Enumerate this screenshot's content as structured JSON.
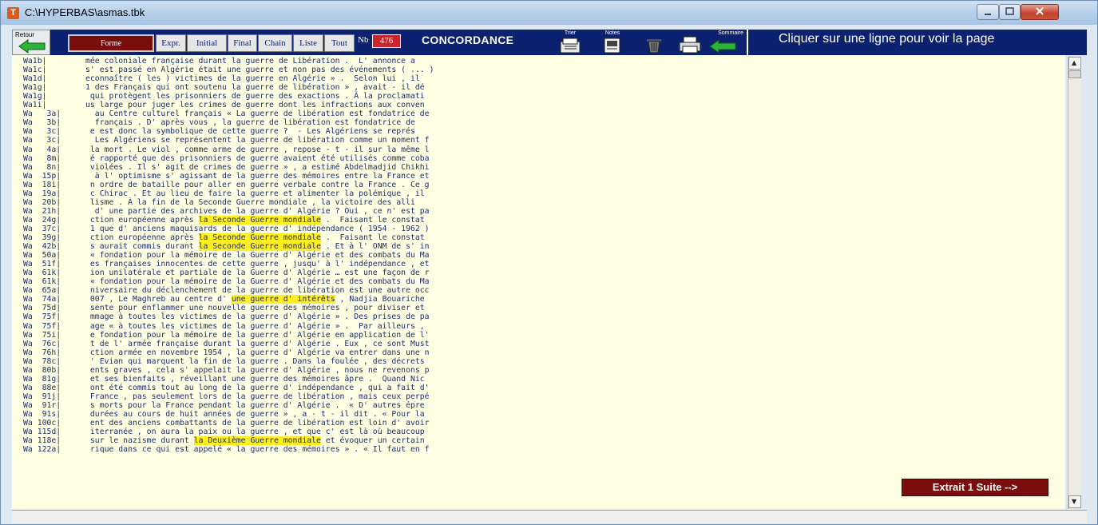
{
  "window": {
    "title": "C:\\HYPERBAS\\asmas.tbk",
    "app_icon": "T"
  },
  "toolbar": {
    "retour_label": "Retour",
    "forme_label": "Forme",
    "expr_label": "Expr.",
    "initial_label": "Initial",
    "final_label": "Final",
    "chain_label": "Chain",
    "liste_label": "Liste",
    "tout_label": "Tout",
    "nb_label": "Nb",
    "nb_value": "476",
    "title": "CONCORDANCE",
    "trier_label": "Trier",
    "notes_label": "Notes",
    "sommaire_label": "Sommaire",
    "message": "Cliquer sur une ligne pour voir la page"
  },
  "concordance": [
    {
      "ref": "Wa1b|",
      "pre": "mée coloniale française durant la guerre de Libération .  L' annonce a",
      "hl": "",
      "post": ""
    },
    {
      "ref": "Wa1c|",
      "pre": "s' est passé en Algérie était une guerre et non pas des événements ( ... )",
      "hl": "",
      "post": ""
    },
    {
      "ref": "Wa1d|",
      "pre": "econnaître ( les ) victimes de la guerre en Algérie » .  Selon lui , il",
      "hl": "",
      "post": ""
    },
    {
      "ref": "Wa1g|",
      "pre": "1 des Français qui ont soutenu la guerre de libération » , avait - il dé",
      "hl": "",
      "post": ""
    },
    {
      "ref": "Wa1g|",
      "pre": " qui protègent les prisonniers de guerre des exactions . À la proclamati",
      "hl": "",
      "post": ""
    },
    {
      "ref": "Wa1i|",
      "pre": "us large pour juger les crimes de guerre dont les infractions aux conven",
      "hl": "",
      "post": ""
    },
    {
      "ref": "Wa   3a|",
      "pre": "  au Centre culturel français « La guerre de libération est fondatrice de",
      "hl": "",
      "post": ""
    },
    {
      "ref": "Wa   3b|",
      "pre": "  français . D' après vous , la guerre de libération est fondatrice de",
      "hl": "",
      "post": ""
    },
    {
      "ref": "Wa   3c|",
      "pre": " e est donc la symbolique de cette guerre ?  - Les Algériens se représ",
      "hl": "",
      "post": ""
    },
    {
      "ref": "Wa   3c|",
      "pre": "  Les Algériens se représentent la guerre de libération comme un moment f",
      "hl": "",
      "post": ""
    },
    {
      "ref": "Wa   4a|",
      "pre": " la mort . Le viol , comme arme de guerre , repose - t - il sur la même l",
      "hl": "",
      "post": ""
    },
    {
      "ref": "Wa   8m|",
      "pre": " é rapporté que des prisonniers de guerre avaient été utilisés comme coba",
      "hl": "",
      "post": ""
    },
    {
      "ref": "Wa   8n|",
      "pre": " violées . Il s' agit de crimes de guerre » , a estimé Abdelmadjid Chikhi",
      "hl": "",
      "post": ""
    },
    {
      "ref": "Wa  15p|",
      "pre": "  à l' optimisme s' agissant de la guerre des mémoires entre la France et",
      "hl": "",
      "post": ""
    },
    {
      "ref": "Wa  18i|",
      "pre": " n ordre de bataille pour aller en guerre verbale contre la France . Ce g",
      "hl": "",
      "post": ""
    },
    {
      "ref": "Wa  19a|",
      "pre": " c Chirac . Et au lieu de faire la guerre et alimenter la polémique , il",
      "hl": "",
      "post": ""
    },
    {
      "ref": "Wa  20b|",
      "pre": " lisme . À la fin de la Seconde Guerre mondiale , la victoire des alli",
      "hl": "",
      "post": ""
    },
    {
      "ref": "Wa  21h|",
      "pre": "  d' une partie des archives de la guerre d' Algérie ? Oui , ce n' est pa",
      "hl": "",
      "post": ""
    },
    {
      "ref": "Wa  24g|",
      "pre": " ction européenne après ",
      "hl": "la Seconde Guerre mondiale",
      "post": " .  Faisant le constat"
    },
    {
      "ref": "Wa  37c|",
      "pre": " 1 que d' anciens maquisards de la guerre d' indépendance ( 1954 - 1962 )",
      "hl": "",
      "post": ""
    },
    {
      "ref": "Wa  39g|",
      "pre": " ction européenne après ",
      "hl": "la Seconde Guerre mondiale",
      "post": " .  Faisant le constat"
    },
    {
      "ref": "Wa  42b|",
      "pre": " s aurait commis durant ",
      "hl": "la Seconde Guerre mondiale",
      "post": " . Et à l' ONM de s' in"
    },
    {
      "ref": "Wa  50a|",
      "pre": " « fondation pour la mémoire de la Guerre d' Algérie et des combats du Ma",
      "hl": "",
      "post": ""
    },
    {
      "ref": "Wa  51f|",
      "pre": " es françaises innocentes de cette guerre , jusqu' à l' indépendance , et",
      "hl": "",
      "post": ""
    },
    {
      "ref": "Wa  61k|",
      "pre": " ion unilatérale et partiale de la Guerre d' Algérie … est une façon de r",
      "hl": "",
      "post": ""
    },
    {
      "ref": "Wa  61k|",
      "pre": " « fondation pour la mémoire de la Guerre d' Algérie et des combats du Ma",
      "hl": "",
      "post": ""
    },
    {
      "ref": "Wa  65a|",
      "pre": " niversaire du déclenchement de la guerre de libération est une autre occ",
      "hl": "",
      "post": ""
    },
    {
      "ref": "Wa  74a|",
      "pre": " 007 , Le Maghreb au centre d' ",
      "hl": "une guerre d' intérêts",
      "post": " , Nadjia Bouariche"
    },
    {
      "ref": "Wa  75d|",
      "pre": " sente pour enflammer une nouvelle guerre des mémoires , pour diviser et",
      "hl": "",
      "post": ""
    },
    {
      "ref": "Wa  75f|",
      "pre": " mmage à toutes les victimes de la guerre d' Algérie » . Des prises de pa",
      "hl": "",
      "post": ""
    },
    {
      "ref": "Wa  75f|",
      "pre": " age « à toutes les victimes de la guerre d' Algérie » .  Par ailleurs ,",
      "hl": "",
      "post": ""
    },
    {
      "ref": "Wa  75i|",
      "pre": " e fondation pour la mémoire de la guerre d' Algérie en application de l'",
      "hl": "",
      "post": ""
    },
    {
      "ref": "Wa  76c|",
      "pre": " t de l' armée française durant la guerre d' Algérie . Eux , ce sont Must",
      "hl": "",
      "post": ""
    },
    {
      "ref": "Wa  76h|",
      "pre": " ction armée en novembre 1954 , la guerre d' Algérie va entrer dans une n",
      "hl": "",
      "post": ""
    },
    {
      "ref": "Wa  78c|",
      "pre": " ' Evian qui marquent la fin de la guerre . Dans la foulée , des décrets",
      "hl": "",
      "post": ""
    },
    {
      "ref": "Wa  80b|",
      "pre": " ents graves , cela s' appelait la guerre d' Algérie , nous ne revenons p",
      "hl": "",
      "post": ""
    },
    {
      "ref": "Wa  81g|",
      "pre": " et ses bienfaits , réveillant une guerre des mémoires âpre .  Quand Nic",
      "hl": "",
      "post": ""
    },
    {
      "ref": "Wa  88e|",
      "pre": " ont été commis tout au long de la guerre d' indépendance , qui a fait d'",
      "hl": "",
      "post": ""
    },
    {
      "ref": "Wa  91j|",
      "pre": " France , pas seulement lors de la guerre de libération , mais ceux perpé",
      "hl": "",
      "post": ""
    },
    {
      "ref": "Wa  91r|",
      "pre": " s morts pour la France pendant la guerre d' Algérie .  « D' autres épre",
      "hl": "",
      "post": ""
    },
    {
      "ref": "Wa  91s|",
      "pre": " durées au cours de huit années de guerre » , a - t - il dit . « Pour la",
      "hl": "",
      "post": ""
    },
    {
      "ref": "Wa 100c|",
      "pre": " ent des anciens combattants de la guerre de libération est loin d' avoir",
      "hl": "",
      "post": ""
    },
    {
      "ref": "Wa 115d|",
      "pre": " iterranée , on aura la paix ou la guerre , et que c' est là où beaucoup",
      "hl": "",
      "post": ""
    },
    {
      "ref": "Wa 118e|",
      "pre": " sur le nazisme durant ",
      "hl": "la Deuxième Guerre mondiale",
      "post": " et évoquer un certain"
    },
    {
      "ref": "Wa 122a|",
      "pre": " rique dans ce qui est appelé « la guerre des mémoires » . « Il faut en f",
      "hl": "",
      "post": ""
    }
  ],
  "extrait_button": "Extrait 1 Suite -->",
  "colors": {
    "toolbar_bg": "#0c2270",
    "content_bg": "#ffffe3",
    "highlight": "#ffee20",
    "button_red": "#7a0e0e"
  }
}
